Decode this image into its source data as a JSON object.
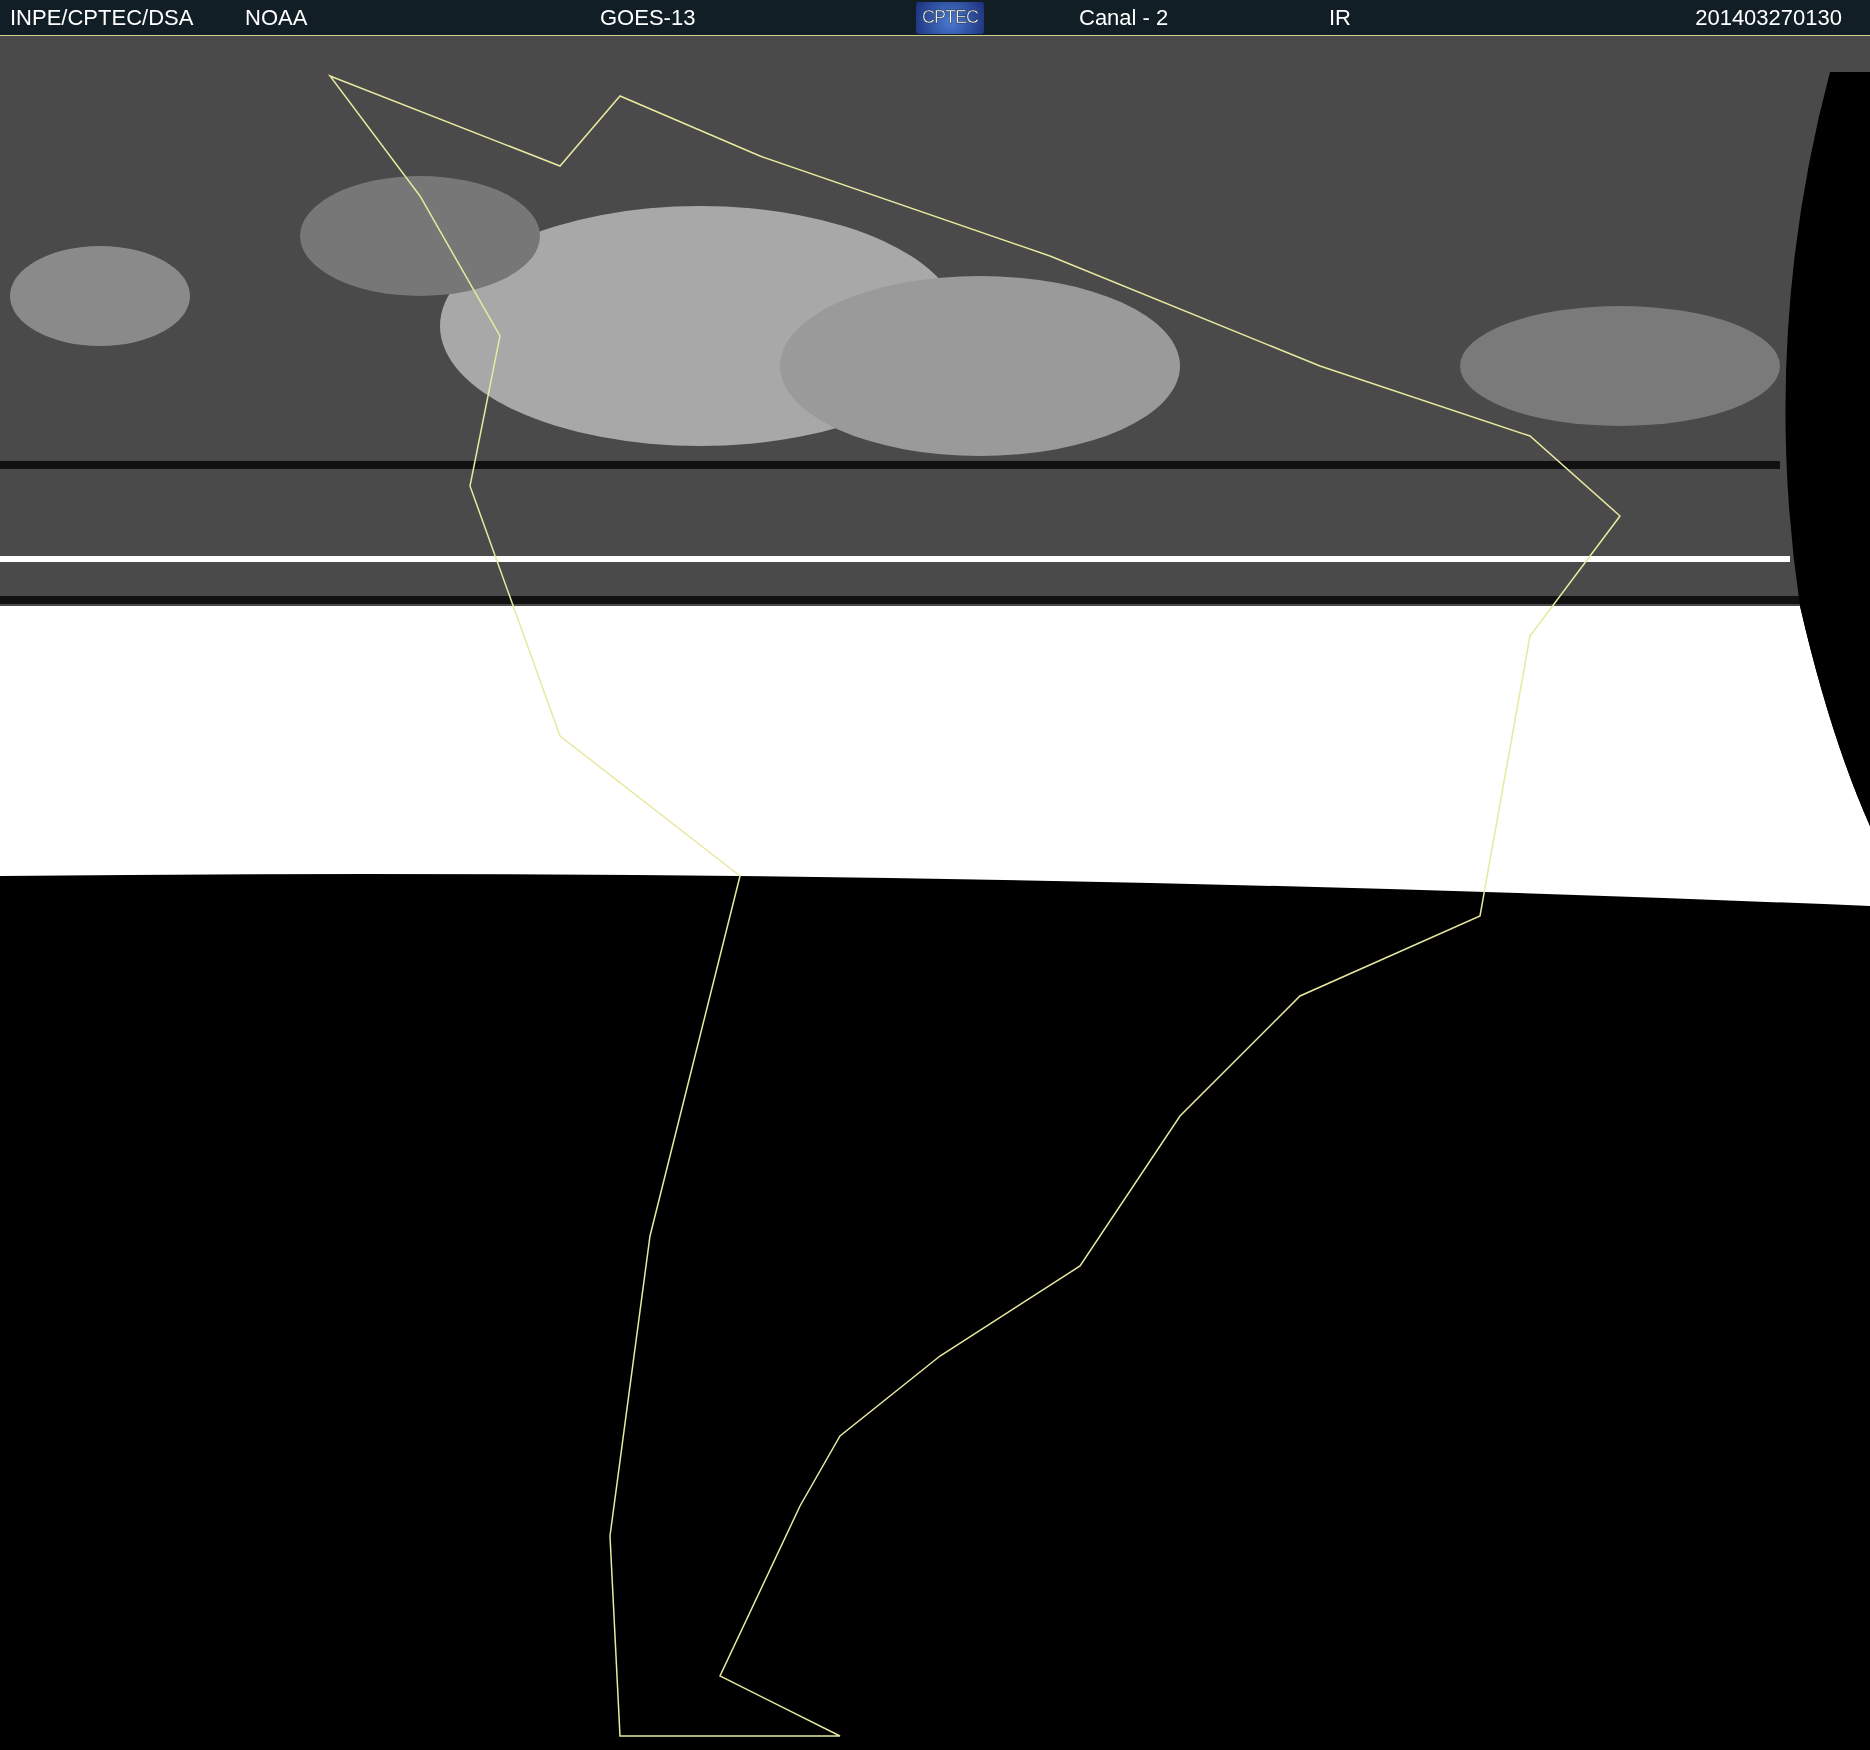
{
  "header": {
    "items": [
      {
        "kind": "text",
        "label": "INPE/CPTEC/DSA"
      },
      {
        "kind": "text",
        "label": "NOAA"
      },
      {
        "kind": "text",
        "label": "GOES-13"
      },
      {
        "kind": "logo",
        "label": "CPTEC"
      },
      {
        "kind": "text",
        "label": "Canal - 2"
      },
      {
        "kind": "text",
        "label": "IR"
      },
      {
        "kind": "text",
        "label": "201403270130"
      }
    ]
  }
}
